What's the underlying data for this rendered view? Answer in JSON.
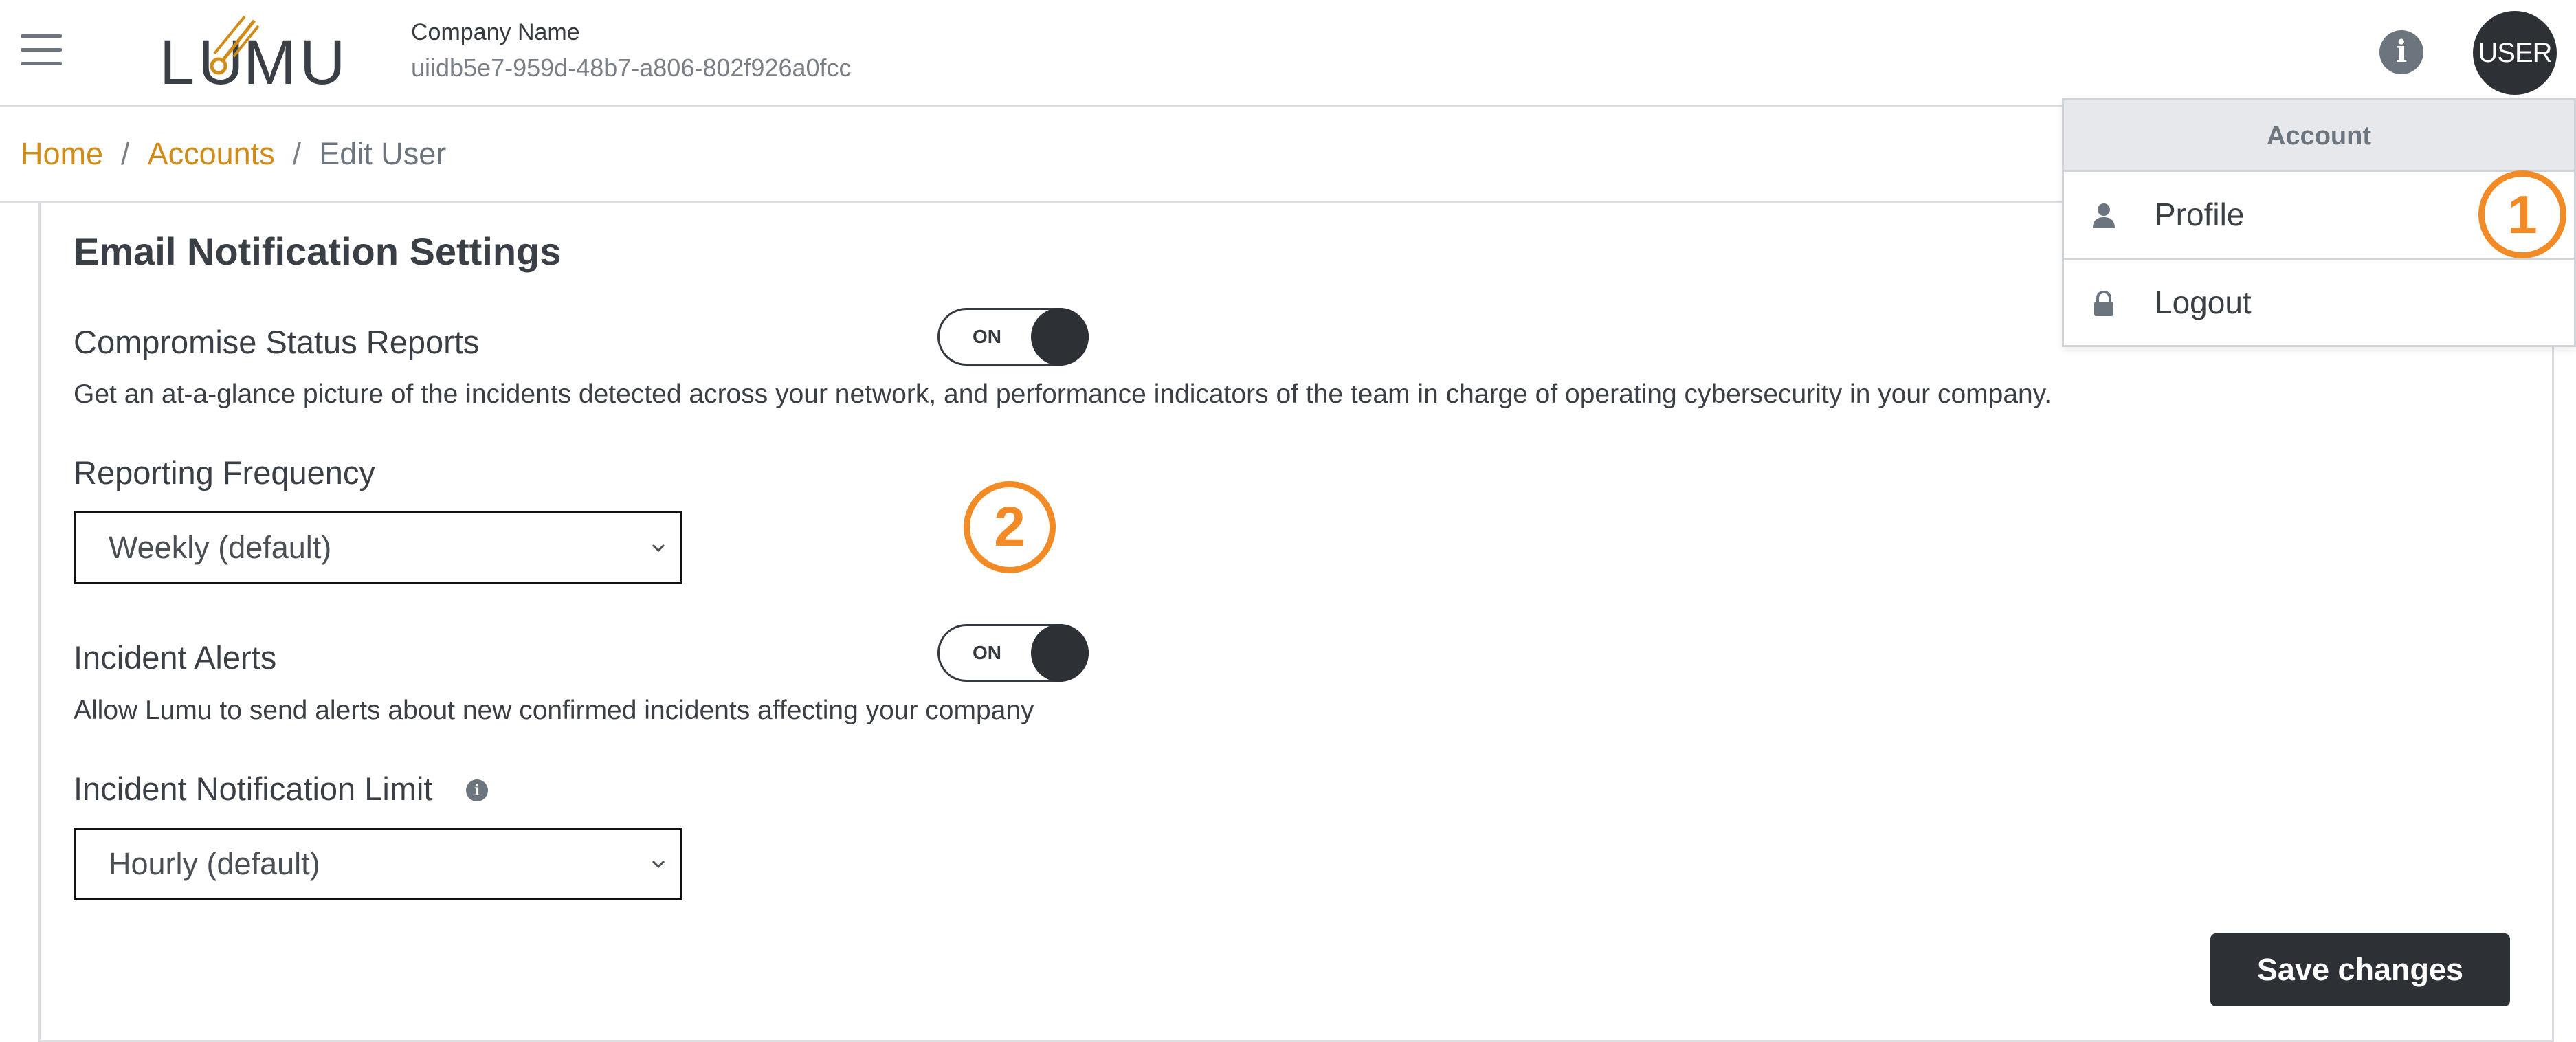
{
  "header": {
    "menu_icon": "hamburger-menu-icon",
    "logo_text": "LUMU",
    "company_name": "Company Name",
    "company_id": "uiidb5e7-959d-48b7-a806-802f926a0fcc",
    "info_icon": "info-icon",
    "info_glyph": "i",
    "avatar_label": "USER"
  },
  "breadcrumb": {
    "home": "Home",
    "separator": "/",
    "accounts": "Accounts",
    "current": "Edit User"
  },
  "account_menu": {
    "header": "Account",
    "items": [
      {
        "label": "Profile",
        "icon": "user-icon"
      },
      {
        "label": "Logout",
        "icon": "lock-icon"
      }
    ]
  },
  "settings": {
    "title": "Email Notification Settings",
    "compromise": {
      "label": "Compromise Status Reports",
      "toggle": "ON",
      "description": "Get an at-a-glance picture of the incidents detected across your network, and performance indicators of the team in charge of operating cybersecurity in your company."
    },
    "frequency": {
      "label": "Reporting Frequency",
      "selected": "Weekly (default)"
    },
    "incident_alerts": {
      "label": "Incident Alerts",
      "toggle": "ON",
      "description": "Allow Lumu to send alerts about new confirmed incidents affecting your company"
    },
    "notification_limit": {
      "label": "Incident Notification Limit",
      "info_glyph": "i",
      "selected": "Hourly (default)"
    },
    "save_label": "Save changes"
  },
  "markers": {
    "one": "1",
    "two": "2"
  },
  "colors": {
    "accent": "#d18b17",
    "marker": "#f28a26",
    "dark": "#2d3136"
  }
}
